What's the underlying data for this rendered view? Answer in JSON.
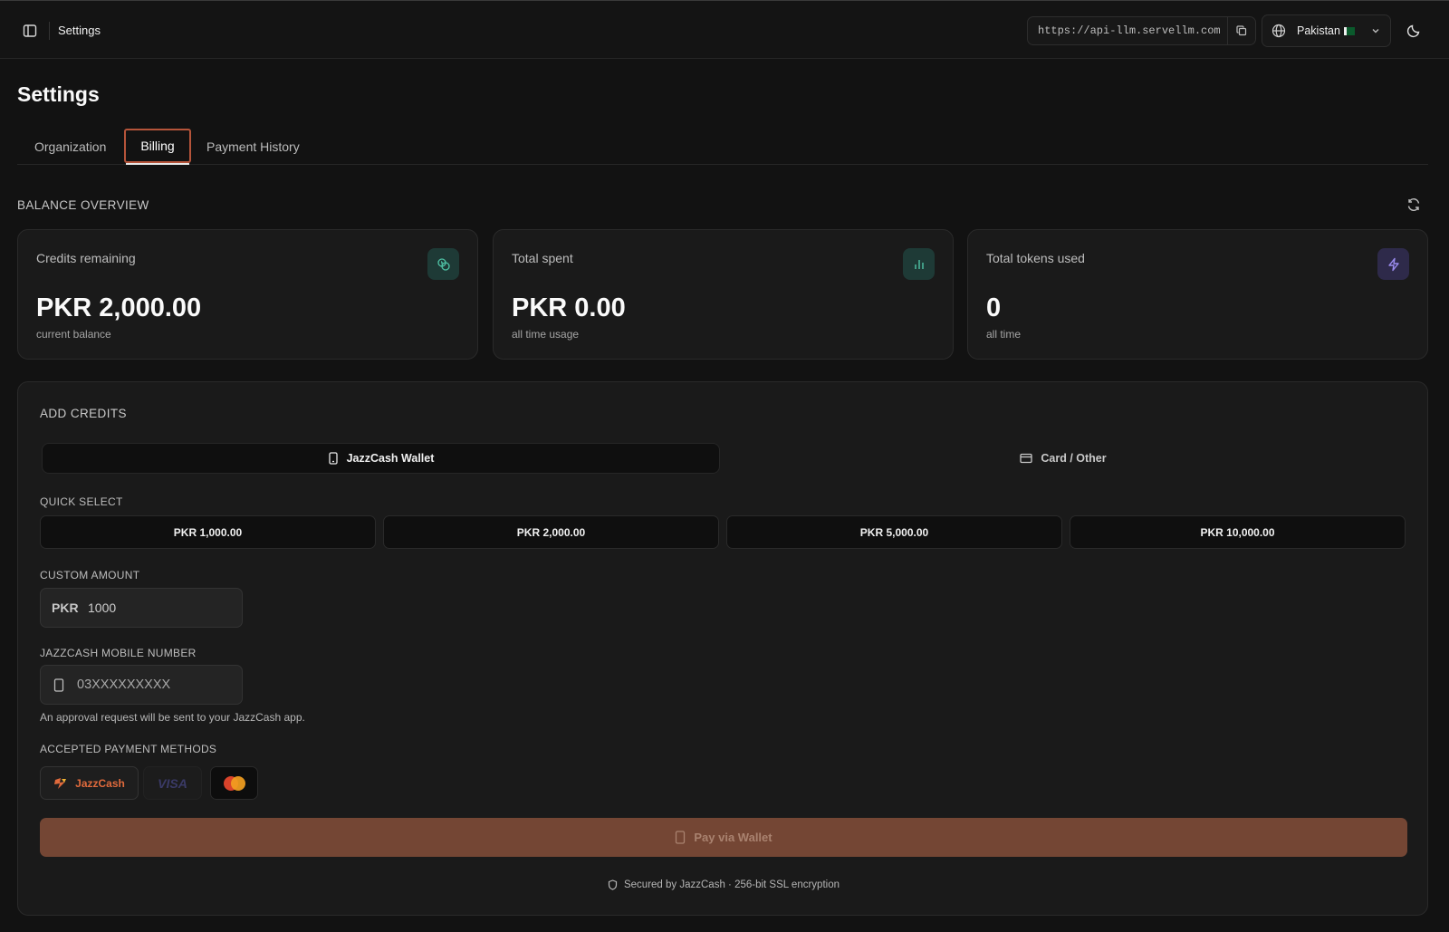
{
  "topbar": {
    "title": "Settings",
    "api_url": "https://api-llm.servellm.com",
    "country": "Pakistan"
  },
  "page": {
    "title": "Settings",
    "tabs": [
      {
        "label": "Organization",
        "active": false
      },
      {
        "label": "Billing",
        "active": true
      },
      {
        "label": "Payment History",
        "active": false
      }
    ]
  },
  "balance": {
    "section_label": "BALANCE OVERVIEW",
    "cards": [
      {
        "label": "Credits remaining",
        "value": "PKR 2,000.00",
        "sub": "current balance",
        "icon": "coins-icon",
        "icon_bg": "#1e3a36",
        "icon_color": "#4fc3a6"
      },
      {
        "label": "Total spent",
        "value": "PKR 0.00",
        "sub": "all time usage",
        "icon": "bar-chart-icon",
        "icon_bg": "#1e3a36",
        "icon_color": "#4fc3a6"
      },
      {
        "label": "Total tokens used",
        "value": "0",
        "sub": "all time",
        "icon": "zap-icon",
        "icon_bg": "#2e2a4a",
        "icon_color": "#9b8cf0"
      }
    ]
  },
  "add_credits": {
    "section_label": "ADD CREDITS",
    "methods": [
      {
        "label": "JazzCash Wallet",
        "active": true
      },
      {
        "label": "Card / Other",
        "active": false
      }
    ],
    "quick_select_label": "QUICK SELECT",
    "quick_amounts": [
      "PKR 1,000.00",
      "PKR 2,000.00",
      "PKR 5,000.00",
      "PKR 10,000.00"
    ],
    "custom_amount_label": "CUSTOM AMOUNT",
    "currency_prefix": "PKR",
    "custom_amount_value": "1000",
    "mobile_label": "JAZZCASH MOBILE NUMBER",
    "mobile_placeholder": "03XXXXXXXXX",
    "mobile_hint": "An approval request will be sent to your JazzCash app.",
    "accepted_label": "ACCEPTED PAYMENT METHODS",
    "payment_methods": [
      "JazzCash",
      "VISA",
      "Mastercard"
    ],
    "pay_button_label": "Pay via Wallet",
    "secured_text": "Secured by JazzCash · 256-bit SSL encryption"
  },
  "colors": {
    "accent": "#b5543a",
    "pay_button": "#744634",
    "background": "#121212"
  }
}
